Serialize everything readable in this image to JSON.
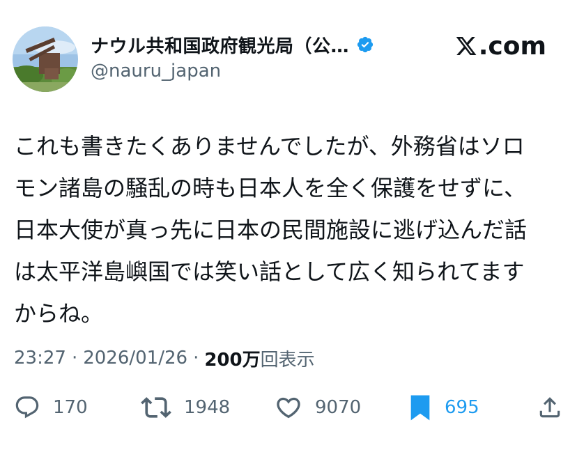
{
  "author": {
    "display_name": "ナウル共和国政府観光局（公…",
    "handle": "@nauru_japan",
    "verified_icon": "verified-badge-icon",
    "verified_color": "#1d9bf0"
  },
  "site": {
    "logo_icon": "x-logo-icon",
    "label": ".com"
  },
  "tweet": {
    "lines": [
      "これも書きたくありませんでしたが、外務省はソロ",
      "モン諸島の騒乱の時も日本人を全く保護をせずに、",
      "日本大使が真っ先に日本の民間施設に逃げ込んだ話",
      "は太平洋島嶼国では笑い話として広く知られてます",
      "からね。"
    ]
  },
  "meta": {
    "time": "23:27",
    "separator": "·",
    "date": "2026/01/26",
    "views_count": "200万",
    "views_label": "回表示"
  },
  "actions": {
    "reply": {
      "icon": "reply-icon",
      "count": "170"
    },
    "repost": {
      "icon": "repost-icon",
      "count": "1948"
    },
    "like": {
      "icon": "heart-icon",
      "count": "9070"
    },
    "bookmark": {
      "icon": "bookmark-icon",
      "count": "695",
      "color": "#1d9bf0"
    },
    "share": {
      "icon": "share-icon"
    }
  },
  "colors": {
    "text": "#0f1419",
    "secondary": "#536471",
    "accent": "#1d9bf0"
  }
}
